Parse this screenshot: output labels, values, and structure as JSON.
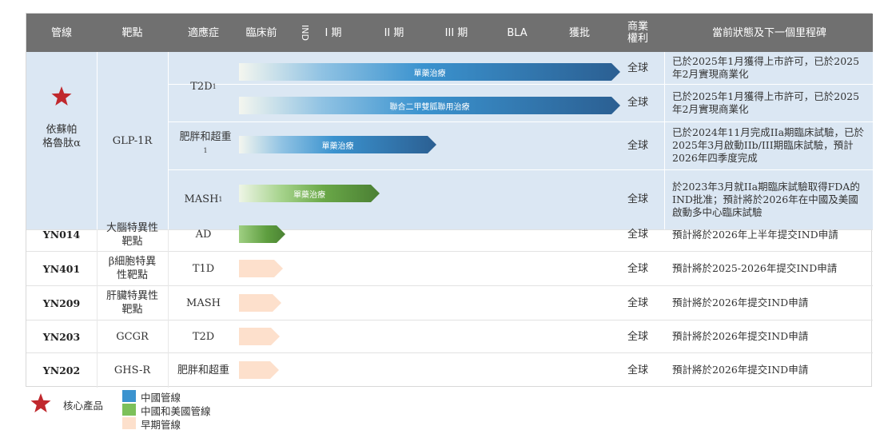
{
  "header": {
    "pipeline": "管線",
    "target": "靶點",
    "indication": "適應症",
    "preclinical": "臨床前",
    "ind": "IND",
    "phase1": "I 期",
    "phase2": "II 期",
    "phase3": "III 期",
    "bla": "BLA",
    "approval": "獲批",
    "rights": "商業\n權利",
    "status": "當前狀態及下一個里程碑"
  },
  "glp": {
    "name": "依蘇帕\n格魯肽α",
    "target": "GLP-1R",
    "rows": [
      {
        "indication": "T2D",
        "sup": "1",
        "bar": "單藥治療",
        "rights": "全球",
        "status": "已於2025年1月獲得上市許可，已於2025年2月實現商業化"
      },
      {
        "bar": "聯合二甲雙胍聯用治療",
        "rights": "全球",
        "status": "已於2025年1月獲得上市許可，已於2025年2月實現商業化"
      },
      {
        "indication": "肥胖和超重",
        "sup": "1",
        "bar": "單藥治療",
        "rights": "全球",
        "status": "已於2024年11月完成IIa期臨床試驗，已於2025年3月啟動IIb/III期臨床試驗，預計2026年四季度完成"
      },
      {
        "indication": "MASH",
        "sup": "1",
        "bar": "單藥治療",
        "rights": "全球",
        "status": "於2023年3月就IIa期臨床試驗取得FDA的IND批准；預計將於2026年在中國及美國啟動多中心臨床試驗"
      }
    ]
  },
  "others": [
    {
      "name": "YN014",
      "target": "大腦特異性\n靶點",
      "indication": "AD",
      "rights": "全球",
      "status": "預計將於2026年上半年提交IND申請"
    },
    {
      "name": "YN401",
      "target": "β細胞特異\n性靶點",
      "indication": "T1D",
      "rights": "全球",
      "status": "預計將於2025-2026年提交IND申請"
    },
    {
      "name": "YN209",
      "target": "肝臟特異性\n靶點",
      "indication": "MASH",
      "rights": "全球",
      "status": "預計將於2026年提交IND申請"
    },
    {
      "name": "YN203",
      "target": "GCGR",
      "indication": "T2D",
      "rights": "全球",
      "status": "預計將於2026年提交IND申請"
    },
    {
      "name": "YN202",
      "target": "GHS-R",
      "indication": "肥胖和超重",
      "rights": "全球",
      "status": "預計將於2026年提交IND申請"
    }
  ],
  "legend": {
    "core": "核心產品",
    "china": "中國管線",
    "china_us": "中國和美國管線",
    "early": "早期管線"
  },
  "colors": {
    "header_bg": "#707070",
    "glp_bg": "#dbe7f3",
    "star": "#c0282d",
    "blue": "#3b93cf",
    "green": "#6aa848",
    "peach": "#fde0cc"
  }
}
